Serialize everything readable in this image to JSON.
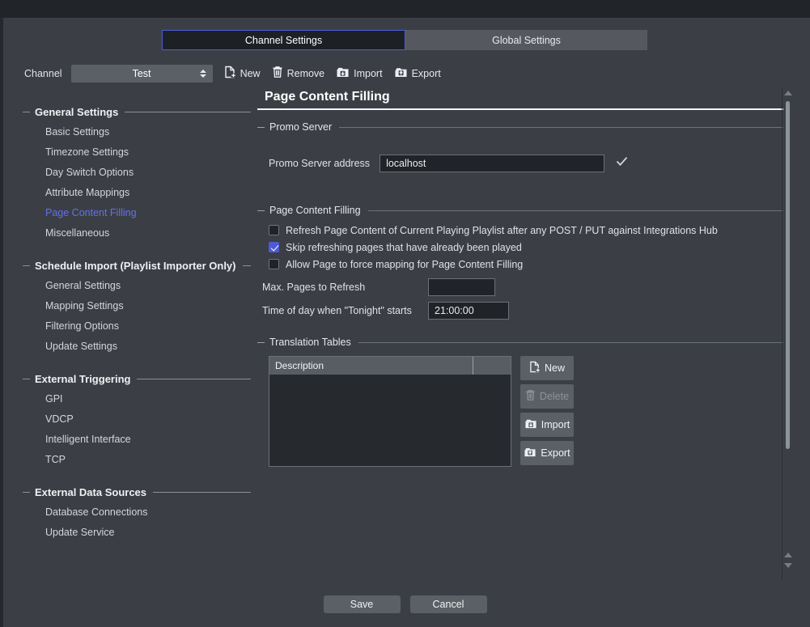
{
  "tabs": [
    {
      "label": "Channel Settings",
      "active": true
    },
    {
      "label": "Global Settings",
      "active": false
    }
  ],
  "toolbar": {
    "channel_label": "Channel",
    "channel_value": "Test",
    "new_label": "New",
    "remove_label": "Remove",
    "import_label": "Import",
    "export_label": "Export"
  },
  "sidebar": {
    "groups": [
      {
        "title": "General Settings",
        "items": [
          {
            "label": "Basic Settings",
            "active": false
          },
          {
            "label": "Timezone Settings",
            "active": false
          },
          {
            "label": "Day Switch Options",
            "active": false
          },
          {
            "label": "Attribute Mappings",
            "active": false
          },
          {
            "label": "Page Content Filling",
            "active": true
          },
          {
            "label": "Miscellaneous",
            "active": false
          }
        ]
      },
      {
        "title": "Schedule Import (Playlist Importer Only)",
        "items": [
          {
            "label": "General Settings",
            "active": false
          },
          {
            "label": "Mapping Settings",
            "active": false
          },
          {
            "label": "Filtering Options",
            "active": false
          },
          {
            "label": "Update Settings",
            "active": false
          }
        ]
      },
      {
        "title": "External Triggering",
        "items": [
          {
            "label": "GPI",
            "active": false
          },
          {
            "label": "VDCP",
            "active": false
          },
          {
            "label": "Intelligent Interface",
            "active": false
          },
          {
            "label": "TCP",
            "active": false
          }
        ]
      },
      {
        "title": "External Data Sources",
        "items": [
          {
            "label": "Database Connections",
            "active": false
          },
          {
            "label": "Update Service",
            "active": false
          }
        ]
      }
    ]
  },
  "main": {
    "page_title": "Page Content Filling",
    "promo_server": {
      "legend": "Promo Server",
      "address_label": "Promo Server address",
      "address_value": "localhost"
    },
    "page_content_filling": {
      "legend": "Page Content Filling",
      "checkboxes": [
        {
          "label": "Refresh Page Content of Current Playing Playlist after any POST / PUT against Integrations Hub",
          "checked": false
        },
        {
          "label": "Skip refreshing pages that have already been played",
          "checked": true
        },
        {
          "label": "Allow Page to force mapping for Page Content Filling",
          "checked": false
        }
      ],
      "max_pages_label": "Max. Pages to Refresh",
      "max_pages_value": "",
      "tonight_label": "Time of day when \"Tonight\" starts",
      "tonight_value": "21:00:00"
    },
    "translation_tables": {
      "legend": "Translation Tables",
      "columns": [
        "Description",
        ""
      ],
      "rows": [],
      "buttons": [
        {
          "label": "New",
          "icon": "new-file-icon",
          "disabled": false
        },
        {
          "label": "Delete",
          "icon": "trash-icon",
          "disabled": true
        },
        {
          "label": "Import",
          "icon": "import-folder-icon",
          "disabled": false
        },
        {
          "label": "Export",
          "icon": "export-folder-icon",
          "disabled": false
        }
      ]
    }
  },
  "footer": {
    "save_label": "Save",
    "cancel_label": "Cancel"
  }
}
